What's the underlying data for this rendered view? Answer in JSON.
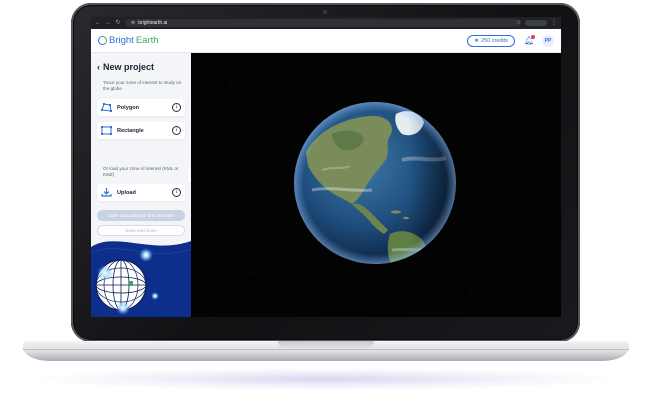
{
  "browser": {
    "url_host": "brightearth.ai",
    "nav_icons": [
      "back-arrow-icon",
      "forward-arrow-icon",
      "reload-icon"
    ]
  },
  "header": {
    "logo_part1": "Bright",
    "logo_part2": "Earth",
    "credits_label": "250 credits",
    "avatar_initials": "PP"
  },
  "sidebar": {
    "title": "New project",
    "hint_draw": "Trace your zone of interest to study on the globe",
    "tools": [
      {
        "label": "Polygon",
        "icon": "polygon-icon"
      },
      {
        "label": "Rectangle",
        "icon": "rectangle-icon"
      }
    ],
    "hint_upload": "Or load your zone of interest (KML or KMZ)",
    "upload": {
      "label": "Upload",
      "icon": "upload-icon"
    },
    "info_glyph": "i",
    "primary_button": "Save and add your first scenario",
    "secondary_button": "Save and close"
  },
  "colors": {
    "accent_blue": "#2f6fd6",
    "accent_green": "#3da85f",
    "notification": "#e03a5c",
    "sidebar_bg": "#f4f5f8",
    "illustration_navy": "#0d2e8a"
  }
}
